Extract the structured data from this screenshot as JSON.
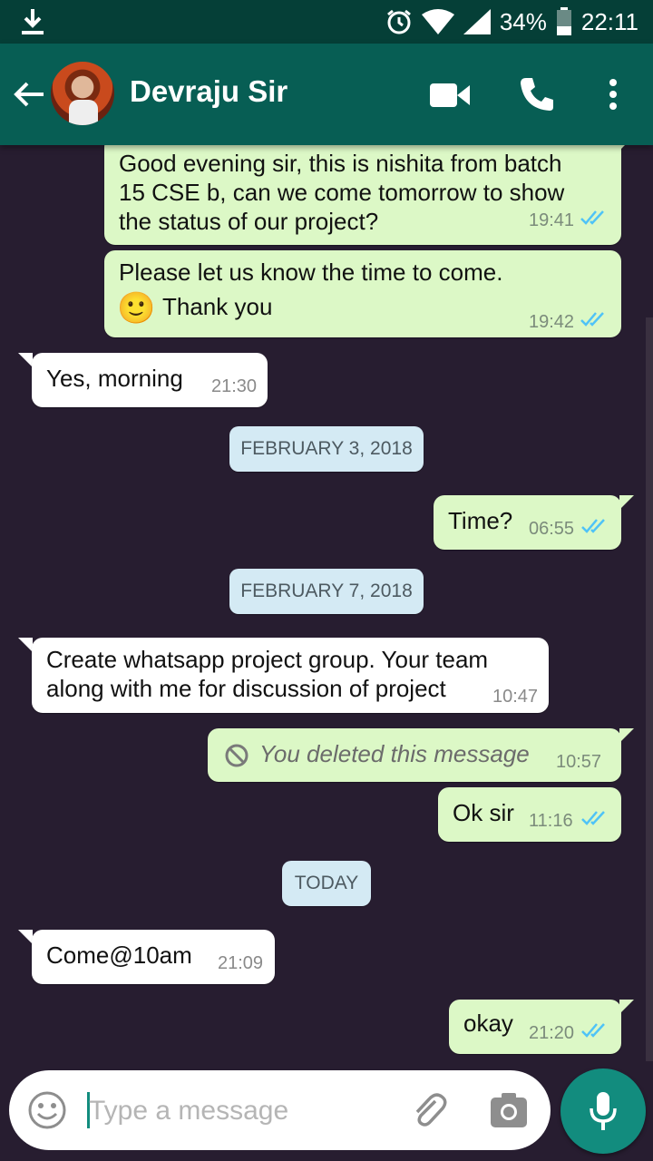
{
  "status_bar": {
    "battery": "34%",
    "time": "22:11"
  },
  "header": {
    "contact_name": "Devraju Sir"
  },
  "messages": [
    {
      "text_lines": [
        "Good evening sir, this is nishita from batch",
        "15 CSE b, can we come tomorrow to show",
        "the status of our project?"
      ],
      "time": "19:41"
    },
    {
      "text_lines": [
        "Please let us know the time to come.",
        "Thank you"
      ],
      "emoji": "🙂",
      "time": "19:42"
    },
    {
      "text": "Yes, morning",
      "time": "21:30"
    },
    {
      "text": "Time?",
      "time": "06:55"
    },
    {
      "text_lines": [
        "Create whatsapp project group. Your team",
        "along with me for discussion of project"
      ],
      "time": "10:47"
    },
    {
      "text": "You deleted this message",
      "time": "10:57"
    },
    {
      "text": "Ok sir",
      "time": "11:16"
    },
    {
      "text": "Come@10am",
      "time": "21:09"
    },
    {
      "text": "okay",
      "time": "21:20"
    }
  ],
  "dates": [
    "FEBRUARY 3, 2018",
    "FEBRUARY 7, 2018",
    "TODAY"
  ],
  "composer": {
    "placeholder": "Type a message"
  },
  "colors": {
    "header": "#075e54",
    "status_bar": "#053f37",
    "outgoing_bubble": "#dcf8c6",
    "incoming_bubble": "#ffffff",
    "read_ticks": "#4fc3f7",
    "mic_button": "#128c7e"
  },
  "icons": [
    "download-icon",
    "alarm-icon",
    "wifi-icon",
    "signal-icon",
    "battery-icon",
    "back-arrow-icon",
    "video-call-icon",
    "phone-icon",
    "more-vert-icon",
    "double-check-icon",
    "blocked-icon",
    "emoji-icon",
    "attach-icon",
    "camera-icon",
    "mic-icon"
  ]
}
